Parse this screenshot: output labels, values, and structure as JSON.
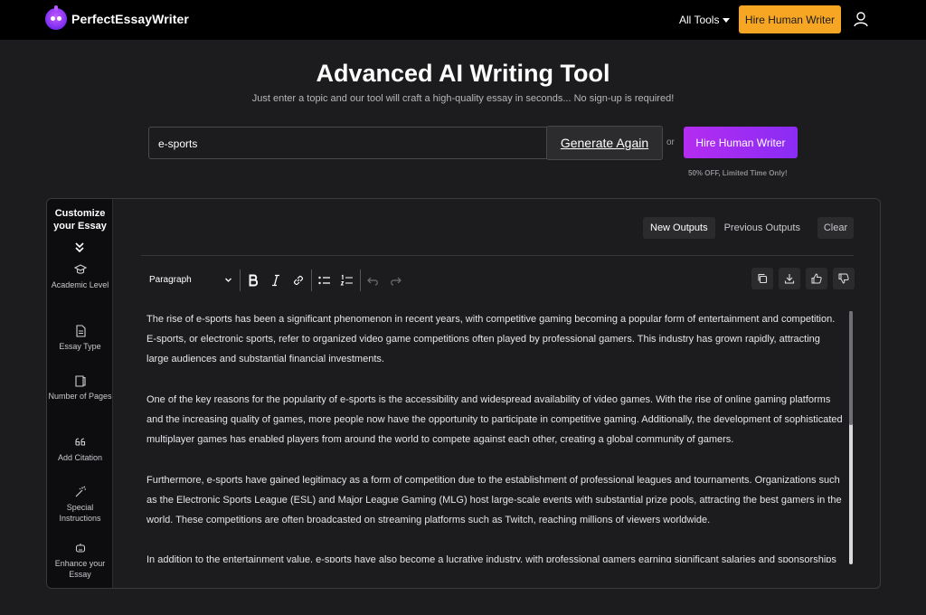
{
  "brand": {
    "name": "PerfectEssayWriter"
  },
  "nav": {
    "all_tools": "All Tools",
    "hire_button": "Hire Human Writer"
  },
  "hero": {
    "title": "Advanced AI Writing Tool",
    "subtitle": "Just enter a topic and our tool will craft a high-quality essay in seconds... No sign-up is required!"
  },
  "form": {
    "topic_value": "e-sports",
    "generate_label": "Generate Again",
    "or_label": "or",
    "hire_label": "Hire Human Writer",
    "promo": "50% OFF, Limited Time Only!"
  },
  "sidebar": {
    "title": "Customize your Essay",
    "items": [
      {
        "label": "Academic Level",
        "icon": "graduation-cap-icon"
      },
      {
        "label": "Essay Type",
        "icon": "document-icon"
      },
      {
        "label": "Number of Pages",
        "icon": "pages-icon"
      },
      {
        "label": "Add Citation",
        "icon": "quote-icon"
      },
      {
        "label": "Special Instructions",
        "icon": "magic-wand-icon"
      },
      {
        "label": "Enhance your Essay",
        "icon": "robot-icon"
      }
    ]
  },
  "output_tabs": {
    "new": "New Outputs",
    "previous": "Previous Outputs",
    "clear": "Clear"
  },
  "editor": {
    "paragraph_style": "Paragraph",
    "paragraphs": [
      "The rise of e-sports has been a significant phenomenon in recent years, with competitive gaming becoming a popular form of entertainment and competition. E-sports, or electronic sports, refer to organized video game competitions often played by professional gamers. This industry has grown rapidly, attracting large audiences and substantial financial investments.",
      "One of the key reasons for the popularity of e-sports is the accessibility and widespread availability of video games. With the rise of online gaming platforms and the increasing quality of games, more people now have the opportunity to participate in competitive gaming. Additionally, the development of sophisticated multiplayer games has enabled players from around the world to compete against each other, creating a global community of gamers.",
      "Furthermore, e-sports have gained legitimacy as a form of competition due to the establishment of professional leagues and tournaments. Organizations such as the Electronic Sports League (ESL) and Major League Gaming (MLG) host large-scale events with substantial prize pools, attracting the best gamers in the world. These competitions are often broadcasted on streaming platforms such as Twitch, reaching millions of viewers worldwide.",
      "In addition to the entertainment value, e-sports have also become a lucrative industry, with professional gamers earning significant salaries and sponsorships"
    ]
  },
  "colors": {
    "accent_orange": "#f6a623",
    "accent_purple": "#b42cf0",
    "background": "#1c1c1e"
  }
}
